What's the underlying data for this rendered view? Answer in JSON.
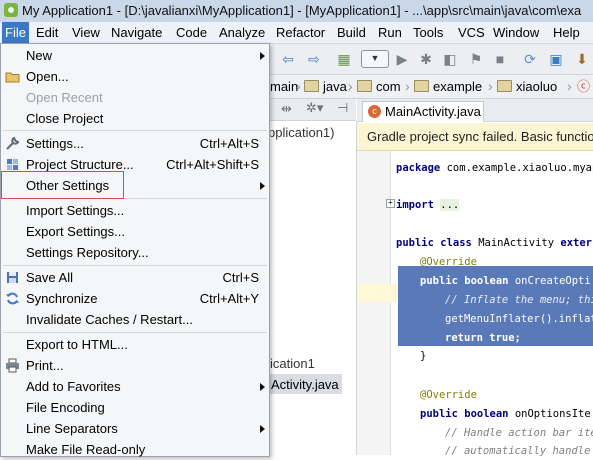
{
  "window": {
    "title": "My Application1 - [D:\\javalianxi\\MyApplication1] - [MyApplication1] - ...\\app\\src\\main\\java\\com\\exa"
  },
  "menubar": {
    "items": [
      "File",
      "Edit",
      "View",
      "Navigate",
      "Code",
      "Analyze",
      "Refactor",
      "Build",
      "Run",
      "Tools",
      "VCS",
      "Window",
      "Help"
    ],
    "active": "File"
  },
  "breadcrumb": {
    "items": [
      "main",
      "java",
      "com",
      "example",
      "xiaoluo"
    ]
  },
  "project_panel": {
    "header_text": "pplication1)",
    "tree": [
      "ication1",
      "Activity.java"
    ],
    "selected": "Activity.java"
  },
  "editor": {
    "tab_label": "MainActivity.java",
    "notice": "Gradle project sync failed. Basic functio",
    "code": {
      "package_kw": "package",
      "package_name": "com.example.xiaoluo.myap",
      "import_kw": "import",
      "import_rest": "...",
      "class_mods": "public class",
      "class_name": "MainActivity",
      "class_ext": "exter",
      "override1": "@Override",
      "method1_mods": "public boolean",
      "method1_name": "onCreateOpti",
      "comment1": "// Inflate the menu; this",
      "inflater": "getMenuInflater().inflate",
      "return_kw": "return",
      "return_val": "true;",
      "close_brace": "}",
      "override2": "@Override",
      "method2_mods": "public boolean",
      "method2_name": "onOptionsIte",
      "comment2": "// Handle action bar item",
      "comment3": "// automatically handle c"
    }
  },
  "file_menu": {
    "items": [
      {
        "label": "New",
        "shortcut": "",
        "submenu": true,
        "disabled": false,
        "icon": ""
      },
      {
        "label": "Open...",
        "shortcut": "",
        "submenu": false,
        "disabled": false,
        "icon": "folder-icon"
      },
      {
        "label": "Open Recent",
        "shortcut": "",
        "submenu": true,
        "disabled": true,
        "icon": ""
      },
      {
        "label": "Close Project",
        "shortcut": "",
        "submenu": false,
        "disabled": false,
        "icon": ""
      },
      {
        "label": "Settings...",
        "shortcut": "Ctrl+Alt+S",
        "submenu": false,
        "disabled": false,
        "icon": "wrench-icon"
      },
      {
        "label": "Project Structure...",
        "shortcut": "Ctrl+Alt+Shift+S",
        "submenu": false,
        "disabled": false,
        "icon": "project-structure-icon"
      },
      {
        "label": "Other Settings",
        "shortcut": "",
        "submenu": true,
        "disabled": false,
        "icon": ""
      },
      {
        "label": "Import Settings...",
        "shortcut": "",
        "submenu": false,
        "disabled": false,
        "icon": ""
      },
      {
        "label": "Export Settings...",
        "shortcut": "",
        "submenu": false,
        "disabled": false,
        "icon": ""
      },
      {
        "label": "Settings Repository...",
        "shortcut": "",
        "submenu": false,
        "disabled": false,
        "icon": ""
      },
      {
        "label": "Save All",
        "shortcut": "Ctrl+S",
        "submenu": false,
        "disabled": false,
        "icon": "save-icon"
      },
      {
        "label": "Synchronize",
        "shortcut": "Ctrl+Alt+Y",
        "submenu": false,
        "disabled": false,
        "icon": "sync-icon"
      },
      {
        "label": "Invalidate Caches / Restart...",
        "shortcut": "",
        "submenu": false,
        "disabled": false,
        "icon": ""
      },
      {
        "label": "Export to HTML...",
        "shortcut": "",
        "submenu": false,
        "disabled": false,
        "icon": ""
      },
      {
        "label": "Print...",
        "shortcut": "",
        "submenu": false,
        "disabled": false,
        "icon": "print-icon"
      },
      {
        "label": "Add to Favorites",
        "shortcut": "",
        "submenu": true,
        "disabled": false,
        "icon": ""
      },
      {
        "label": "File Encoding",
        "shortcut": "",
        "submenu": false,
        "disabled": false,
        "icon": ""
      },
      {
        "label": "Line Separators",
        "shortcut": "",
        "submenu": true,
        "disabled": false,
        "icon": ""
      },
      {
        "label": "Make File Read-only",
        "shortcut": "",
        "submenu": false,
        "disabled": false,
        "icon": ""
      }
    ],
    "highlighted": "Settings..."
  }
}
